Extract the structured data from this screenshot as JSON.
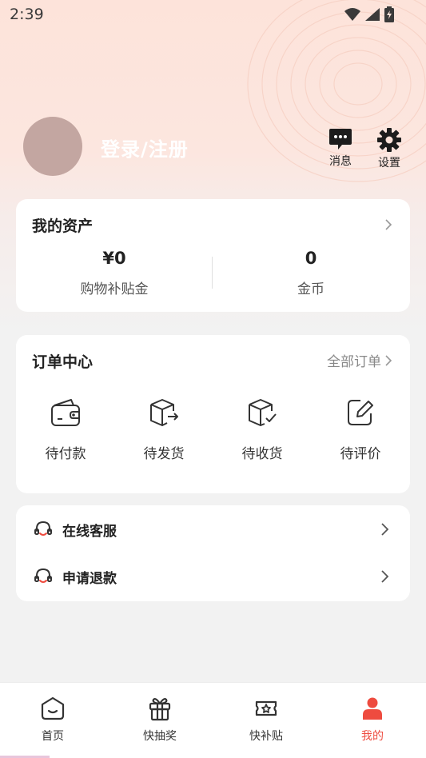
{
  "status_bar": {
    "time": "2:39"
  },
  "profile": {
    "login_label": "登录/注册"
  },
  "header_actions": {
    "messages_label": "消息",
    "settings_label": "设置"
  },
  "assets": {
    "title": "我的资产",
    "items": [
      {
        "value": "¥0",
        "label": "购物补贴金"
      },
      {
        "value": "0",
        "label": "金币"
      }
    ]
  },
  "orders": {
    "title": "订单中心",
    "all_label": "全部订单",
    "items": [
      {
        "label": "待付款",
        "icon": "wallet-icon"
      },
      {
        "label": "待发货",
        "icon": "box-ship-icon"
      },
      {
        "label": "待收货",
        "icon": "box-receive-icon"
      },
      {
        "label": "待评价",
        "icon": "edit-review-icon"
      }
    ]
  },
  "services": [
    {
      "label": "在线客服",
      "icon": "headset-icon"
    },
    {
      "label": "申请退款",
      "icon": "headset-icon"
    }
  ],
  "tabbar": {
    "tabs": [
      {
        "label": "首页",
        "icon": "home-icon"
      },
      {
        "label": "快抽奖",
        "icon": "gift-icon"
      },
      {
        "label": "快补贴",
        "icon": "coupon-icon"
      },
      {
        "label": "我的",
        "icon": "user-icon"
      }
    ],
    "active_index": 3
  },
  "colors": {
    "accent": "#ee4b3f",
    "avatar": "#c3a6a1",
    "header_bg": "#fde3da"
  }
}
